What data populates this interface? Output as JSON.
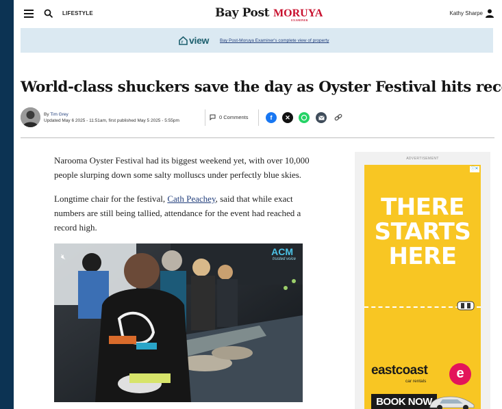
{
  "header": {
    "section_label": "LIFESTYLE",
    "logo_main": "Bay Post",
    "logo_secondary": "MORUYA",
    "logo_secondary_sub": "EXAMINER",
    "user_name": "Kathy Sharpe"
  },
  "banner": {
    "logo_text": "view",
    "link_text": "Bay Post-Moruya Examiner's complete view of property"
  },
  "article": {
    "headline": "World-class shuckers save the day as Oyster Festival hits record high",
    "byline_prefix": "By ",
    "author": "Tim Grey",
    "updated": "Updated May 6 2025 - 11:51am, first published May 5 2025 - 5:55pm",
    "comments": "0 Comments",
    "para1_line1": "Narooma Oyster Festival had its biggest weekend yet, with over 10,000",
    "para1_line2": "people slurping down some salty molluscs under perfectly blue skies.",
    "para2_line1_before": "Longtime chair for the festival, ",
    "para2_link": "Cath Peachey",
    "para2_line1_after": ", said that while exact",
    "para2_line2": "numbers are still being tallied, attendance for the event had reached a",
    "para2_line3": "record high.",
    "photo_badge": "ACM",
    "photo_badge_sub": "trusted voice"
  },
  "ad": {
    "label": "ADVERTISEMENT",
    "headline_line1": "THERE",
    "headline_line2": "STARTS",
    "headline_line3": "HERE",
    "brand_part1": "east",
    "brand_part2": "coast",
    "brand_sub": "car rentals",
    "cta": "BOOK NOW",
    "colors": {
      "background": "#f8c623",
      "accent": "#e3155a"
    }
  },
  "share": [
    "facebook-icon",
    "x-icon",
    "whatsapp-icon",
    "email-icon",
    "link-icon"
  ]
}
